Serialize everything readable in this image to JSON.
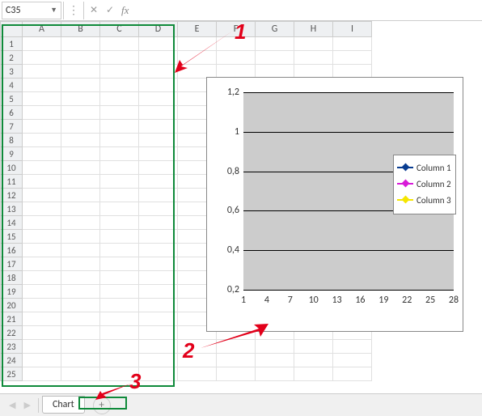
{
  "formula_bar": {
    "cell_ref": "C35",
    "fx_label": "fx",
    "formula_value": ""
  },
  "columns": [
    "A",
    "B",
    "C",
    "D",
    "E",
    "F",
    "G",
    "H",
    "I"
  ],
  "row_count": 25,
  "sheet_tabs": {
    "active": "Chart",
    "add_label": "+"
  },
  "chart_data": {
    "type": "line",
    "series": [
      {
        "name": "Column 1",
        "values": []
      },
      {
        "name": "Column 2",
        "values": []
      },
      {
        "name": "Column 3",
        "values": []
      }
    ],
    "x_ticks": [
      1,
      4,
      7,
      10,
      13,
      16,
      19,
      22,
      25,
      28
    ],
    "y_ticks": [
      "1,2",
      "1",
      "0,8",
      "0,6",
      "0,4",
      "0,2"
    ],
    "ylim": [
      0,
      1.2
    ],
    "xlabel": "",
    "ylabel": ""
  },
  "annotations": {
    "a1": "1",
    "a2": "2",
    "a3": "3"
  }
}
